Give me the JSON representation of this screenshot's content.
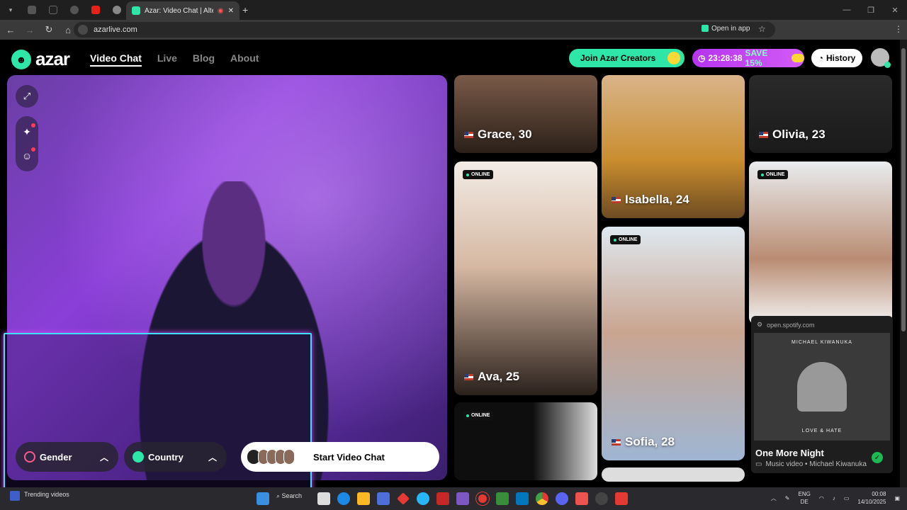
{
  "browser": {
    "active_tab_title": "Azar: Video Chat | Alternati",
    "url": "azarlive.com",
    "open_in_app": "Open in app"
  },
  "nav": {
    "logo": "azar",
    "links": [
      "Video Chat",
      "Live",
      "Blog",
      "About"
    ]
  },
  "header": {
    "creators_label": "Join Azar Creators",
    "timer": "23:28:38",
    "save_label": "SAVE 15%",
    "history_label": "History"
  },
  "video": {
    "gender_label": "Gender",
    "country_label": "Country",
    "start_label": "Start Video Chat"
  },
  "profiles": [
    {
      "name": "Grace, 30",
      "online": false
    },
    {
      "name": "Isabella, 24",
      "online": false
    },
    {
      "name": "Olivia, 23",
      "online": false
    },
    {
      "name": "Ava, 25",
      "online": true
    },
    {
      "name": "Sofia, 28",
      "online": true
    },
    {
      "name": "",
      "online": true
    },
    {
      "name": "",
      "online": true
    }
  ],
  "online_label": "ONLINE",
  "spotify": {
    "source": "open.spotify.com",
    "artist_top": "MICHAEL KIWANUKA",
    "album": "LOVE & HATE",
    "title": "One More Night",
    "subtitle": "Music video • Michael Kiwanuka"
  },
  "taskbar": {
    "news_title": "Trending videos",
    "search": "Search",
    "lang1": "ENG",
    "lang2": "DE",
    "time": "00:08",
    "date": "14/10/2025"
  },
  "colors": {
    "accent": "#2ee6a8",
    "promo": "#b534f0",
    "selfie_border": "#3fe0ff"
  }
}
